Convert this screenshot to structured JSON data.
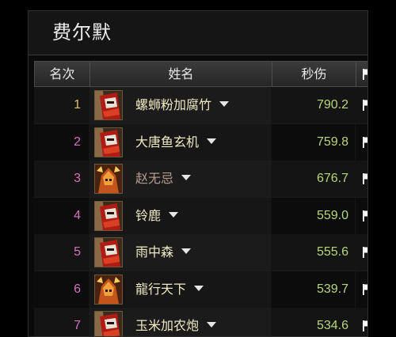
{
  "panel": {
    "title": "费尔默"
  },
  "table": {
    "headers": {
      "rank": "名次",
      "name": "姓名",
      "dps": "秒伤"
    },
    "rows": [
      {
        "rank": "1",
        "name": "螺蛳粉加腐竹",
        "dps": "790.2",
        "avatar": "red-warrior"
      },
      {
        "rank": "2",
        "name": "大唐鱼玄机",
        "dps": "759.8",
        "avatar": "red-warrior"
      },
      {
        "rank": "3",
        "name": "赵无忌",
        "dps": "676.7",
        "avatar": "orange-mage"
      },
      {
        "rank": "4",
        "name": "铃鹿",
        "dps": "559.0",
        "avatar": "red-warrior"
      },
      {
        "rank": "5",
        "name": "雨中森",
        "dps": "555.6",
        "avatar": "red-warrior"
      },
      {
        "rank": "6",
        "name": "龍行天下",
        "dps": "539.7",
        "avatar": "orange-mage"
      },
      {
        "rank": "7",
        "name": "玉米加农炮",
        "dps": "534.6",
        "avatar": "red-warrior"
      }
    ]
  },
  "colors": {
    "rank_gold": "#d9c25e",
    "rank_pink": "#d670c2",
    "dps_green": "#b8d67a",
    "name_cream": "#f0e9c4"
  }
}
